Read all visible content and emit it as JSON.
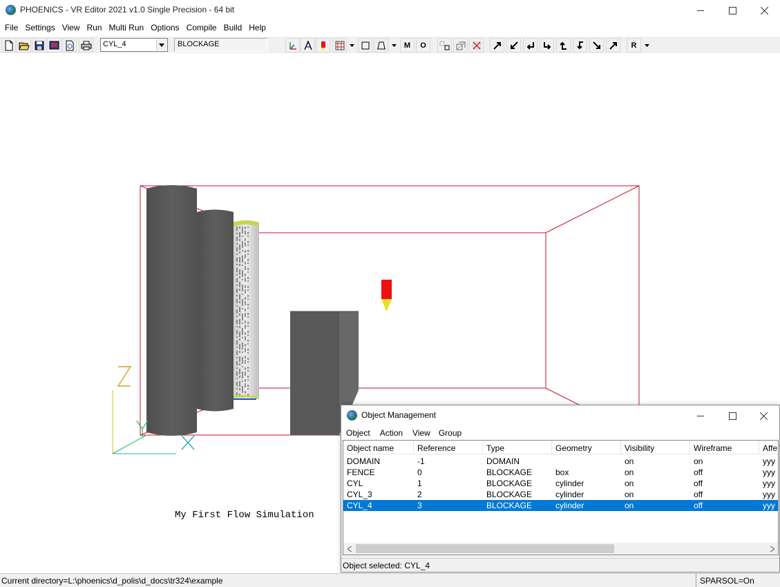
{
  "app": {
    "title": "PHOENICS - VR Editor 2021 v1.0 Single Precision - 64 bit"
  },
  "menubar": [
    "File",
    "Settings",
    "View",
    "Run",
    "Multi Run",
    "Options",
    "Compile",
    "Build",
    "Help"
  ],
  "toolbar": {
    "object_select": "CYL_4",
    "object_type": "BLOCKAGE",
    "button_M": "M",
    "button_O": "O",
    "button_R": "R"
  },
  "viewport": {
    "caption": "My First Flow Simulation",
    "axis_labels": {
      "z": "Z",
      "y": "Y",
      "x": "X"
    },
    "colors": {
      "domain_edges": "#c8102e",
      "object_gray": "#595959",
      "probe_red": "#ee1111",
      "probe_yellow": "#e8e020"
    }
  },
  "object_management": {
    "title": "Object Management",
    "menu": [
      "Object",
      "Action",
      "View",
      "Group"
    ],
    "columns": [
      "Object name",
      "Reference",
      "Type",
      "Geometry",
      "Visibility",
      "Wireframe",
      "Affe"
    ],
    "rows": [
      {
        "name": "DOMAIN",
        "ref": "-1",
        "type": "DOMAIN",
        "geometry": "",
        "visibility": "on",
        "wireframe": "on",
        "affects": "yyy",
        "selected": false
      },
      {
        "name": "FENCE",
        "ref": "0",
        "type": "BLOCKAGE",
        "geometry": "box",
        "visibility": "on",
        "wireframe": "off",
        "affects": "yyy",
        "selected": false
      },
      {
        "name": "CYL",
        "ref": "1",
        "type": "BLOCKAGE",
        "geometry": "cylinder",
        "visibility": "on",
        "wireframe": "off",
        "affects": "yyy",
        "selected": false
      },
      {
        "name": "CYL_3",
        "ref": "2",
        "type": "BLOCKAGE",
        "geometry": "cylinder",
        "visibility": "on",
        "wireframe": "off",
        "affects": "yyy",
        "selected": false
      },
      {
        "name": "CYL_4",
        "ref": "3",
        "type": "BLOCKAGE",
        "geometry": "cylinder",
        "visibility": "on",
        "wireframe": "off",
        "affects": "yyy",
        "selected": true
      }
    ],
    "status": "Object selected: CYL_4"
  },
  "statusbar": {
    "directory": "Current directory=L:\\phoenics\\d_polis\\d_docs\\tr324\\example",
    "sparsol": "SPARSOL=On"
  }
}
